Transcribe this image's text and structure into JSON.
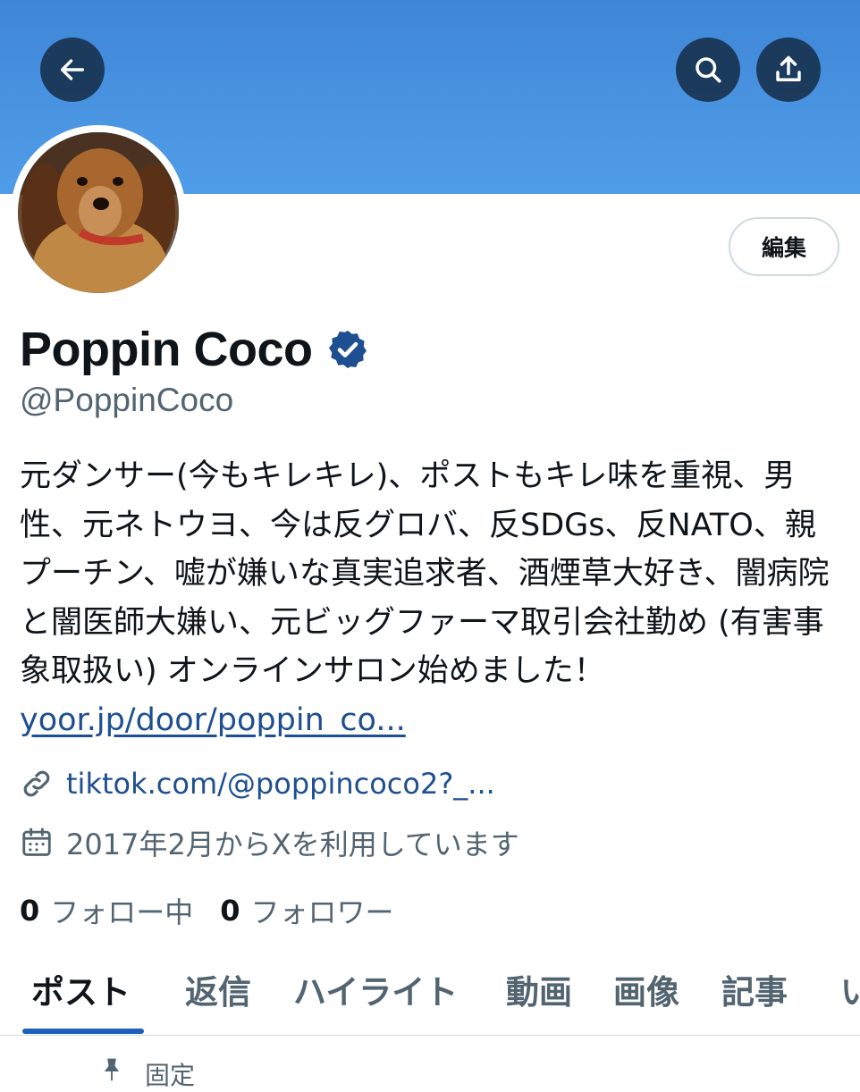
{
  "header": {
    "back_icon": "arrow-left-icon",
    "search_icon": "search-icon",
    "share_icon": "share-icon",
    "banner_color": "#4a95e2"
  },
  "profile": {
    "edit_label": "編集",
    "display_name": "Poppin Coco",
    "verified_color": "#1d4f91",
    "handle": "@PoppinCoco",
    "bio_text": "元ダンサー(今もキレキレ)、ポストもキレ味を重視、男性、元ネトウヨ、今は反グロバ、反SDGs、反NATO、親プーチン、嘘が嫌いな真実追求者、酒煙草大好き、闇病院と闇医師大嫌い、元ビッグファーマ取引会社勤め (有害事象取扱い) オンラインサロン始めました！",
    "bio_link": "yoor.jp/door/poppin_co...",
    "website": "tiktok.com/@poppincoco2?_...",
    "joined": "2017年2月からXを利用しています",
    "following_count": "0",
    "following_label": "フォロー中",
    "followers_count": "0",
    "followers_label": "フォロワー"
  },
  "tabs": [
    {
      "label": "ポスト"
    },
    {
      "label": "返信"
    },
    {
      "label": "ハイライト"
    },
    {
      "label": "動画"
    },
    {
      "label": "画像"
    },
    {
      "label": "記事"
    },
    {
      "label": "い"
    }
  ],
  "pinned_label": "固定"
}
